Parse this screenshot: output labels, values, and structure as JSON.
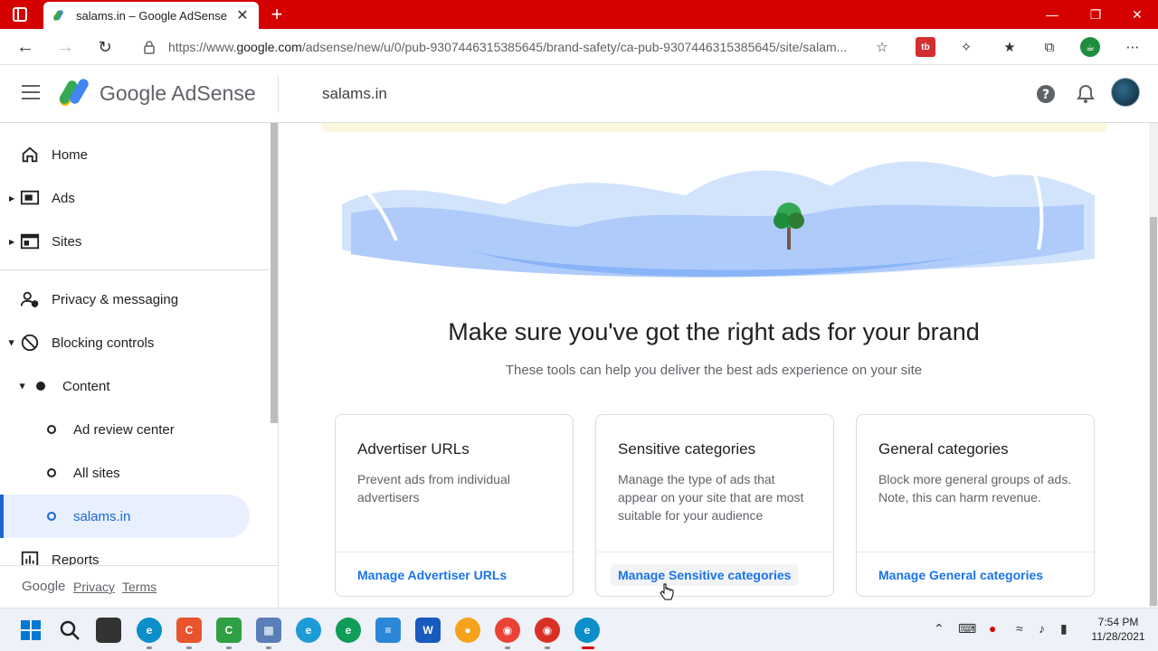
{
  "browser": {
    "tab_title": "salams.in – Google AdSense",
    "url_prefix": "https://www.",
    "url_host": "google.com",
    "url_path": "/adsense/new/u/0/pub-9307446315385645/brand-safety/ca-pub-9307446315385645/site/salam...",
    "new_tab_symbol": "+",
    "close_symbol": "✕"
  },
  "header": {
    "brand_name": "Google AdSense",
    "site_title": "salams.in"
  },
  "sidebar": {
    "home": "Home",
    "ads": "Ads",
    "sites": "Sites",
    "privacy": "Privacy & messaging",
    "blocking": "Blocking controls",
    "content": "Content",
    "ad_review": "Ad review center",
    "all_sites": "All sites",
    "salams": "salams.in",
    "reports": "Reports",
    "footer_google": "Google",
    "footer_privacy": "Privacy",
    "footer_terms": "Terms"
  },
  "main": {
    "headline": "Make sure you've got the right ads for your brand",
    "subline": "These tools can help you deliver the best ads experience on your site",
    "cards": [
      {
        "title": "Advertiser URLs",
        "desc": "Prevent ads from individual advertisers",
        "link": "Manage Advertiser URLs"
      },
      {
        "title": "Sensitive categories",
        "desc": "Manage the type of ads that appear on your site that are most suitable for your audience",
        "link": "Manage Sensitive categories"
      },
      {
        "title": "General categories",
        "desc": "Block more general groups of ads. Note, this can harm revenue.",
        "link": "Manage General categories"
      }
    ]
  },
  "taskbar": {
    "time": "7:54 PM",
    "date": "11/28/2021"
  },
  "colors": {
    "titlebar": "#d50000",
    "accent": "#1a73e8",
    "active_nav": "#1967d2"
  }
}
